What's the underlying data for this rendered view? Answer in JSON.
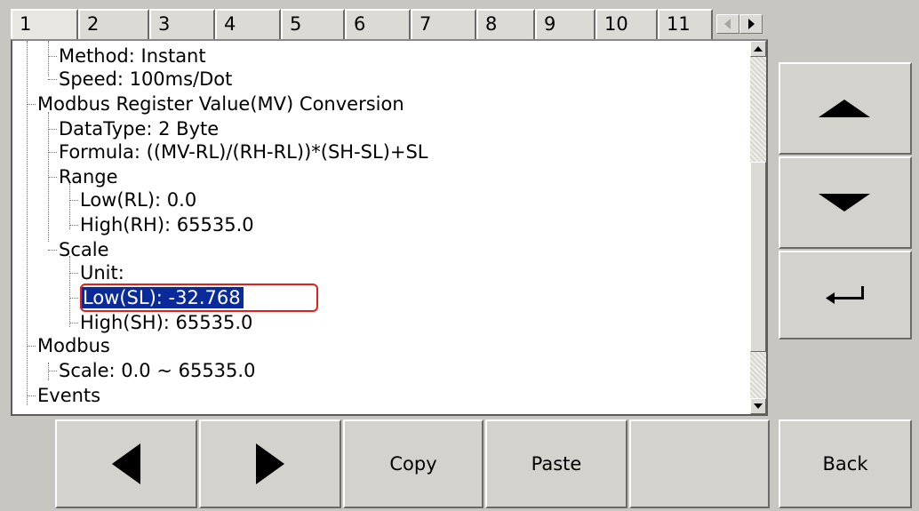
{
  "tabs": [
    {
      "label": "1",
      "active": true
    },
    {
      "label": "2"
    },
    {
      "label": "3"
    },
    {
      "label": "4"
    },
    {
      "label": "5"
    },
    {
      "label": "6"
    },
    {
      "label": "7"
    },
    {
      "label": "8"
    },
    {
      "label": "9"
    },
    {
      "label": "10"
    },
    {
      "label": "11"
    }
  ],
  "tree": [
    {
      "text": "Method: Instant"
    },
    {
      "text": "Speed: 100ms/Dot"
    },
    {
      "text": "Modbus Register Value(MV) Conversion"
    },
    {
      "text": "DataType: 2 Byte"
    },
    {
      "text": "Formula: ((MV-RL)/(RH-RL))*(SH-SL)+SL"
    },
    {
      "text": "Range"
    },
    {
      "text": "Low(RL): 0.0"
    },
    {
      "text": "High(RH): 65535.0"
    },
    {
      "text": "Scale"
    },
    {
      "text": "Unit:"
    },
    {
      "text": "Low(SL): -32.768",
      "selected": true
    },
    {
      "text": "High(SH): 65535.0"
    },
    {
      "text": "Modbus"
    },
    {
      "text": "Scale: 0.0 ~ 65535.0"
    },
    {
      "text": "Events"
    }
  ],
  "side_buttons": {
    "up_icon": "arrow-up-icon",
    "down_icon": "arrow-down-icon",
    "enter_icon": "enter-icon",
    "back_label": "Back"
  },
  "bottom_buttons": {
    "left_icon": "arrow-left-icon",
    "right_icon": "arrow-right-icon",
    "copy_label": "Copy",
    "paste_label": "Paste"
  },
  "colors": {
    "selection_bg": "#0a2a9a",
    "highlight_box": "#e0201a",
    "background": "#c8c6c0"
  }
}
